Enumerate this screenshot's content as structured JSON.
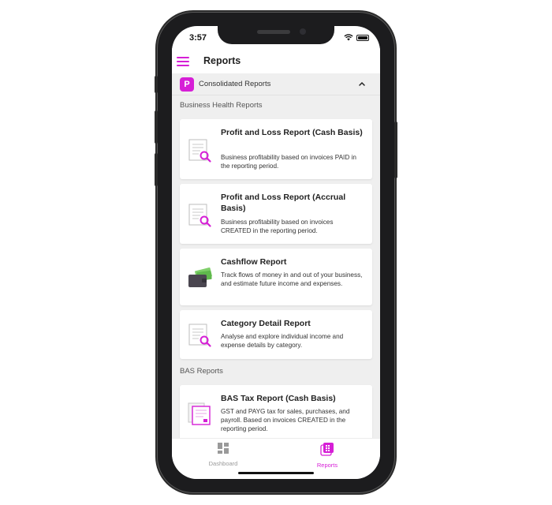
{
  "status": {
    "time": "3:57"
  },
  "nav": {
    "title": "Reports"
  },
  "consolidated": {
    "logo_letter": "P",
    "label": "Consolidated Reports"
  },
  "sections": {
    "business_health": "Business Health Reports",
    "bas": "BAS Reports"
  },
  "reports": [
    {
      "title": "Profit and Loss Report (Cash Basis)",
      "desc": "Business profitability based on invoices PAID in the reporting period.",
      "icon": "report-search-icon"
    },
    {
      "title": "Profit and Loss Report (Accrual Basis)",
      "desc": "Business profitability based on invoices CREATED in the reporting period.",
      "icon": "report-search-icon"
    },
    {
      "title": "Cashflow Report",
      "desc": "Track flows of money in and out of your business, and estimate future income and expenses.",
      "icon": "wallet-cash-icon"
    },
    {
      "title": "Category Detail Report",
      "desc": "Analyse and explore individual income and expense details by category.",
      "icon": "report-search-icon"
    },
    {
      "title": "BAS Tax Report (Cash Basis)",
      "desc": "GST and PAYG tax for sales, purchases, and payroll. Based on invoices CREATED in the reporting period.",
      "icon": "tax-form-icon"
    }
  ],
  "tabs": [
    {
      "label": "Dashboard",
      "active": false
    },
    {
      "label": "Reports",
      "active": true
    }
  ],
  "colors": {
    "accent": "#d61fd6",
    "inactive": "#9a9a9a",
    "background": "#efefef"
  }
}
